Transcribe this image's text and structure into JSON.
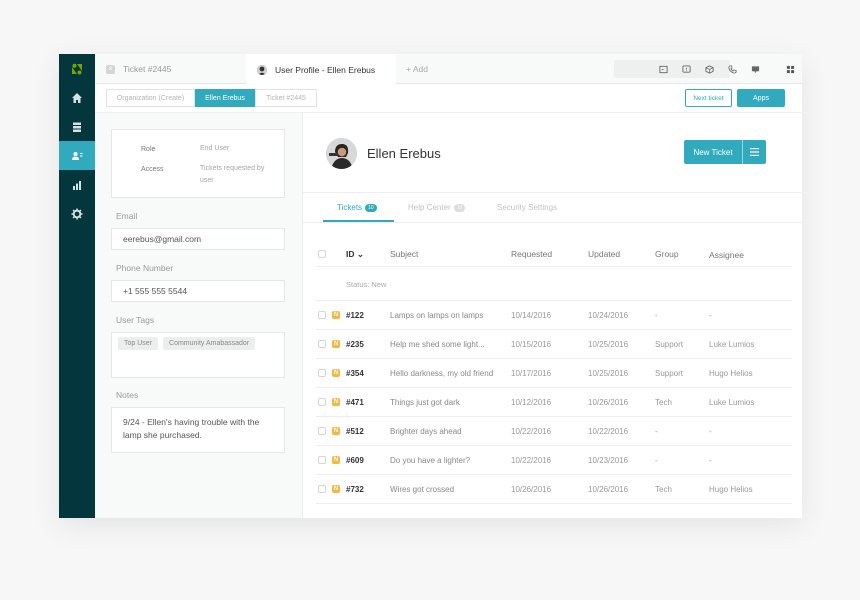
{
  "tabs": {
    "ticket": "Ticket #2445",
    "user_profile": "User Profile - Ellen Erebus",
    "add": "+ Add"
  },
  "breadcrumbs": [
    "Organization (Create)",
    "Ellen Erebus",
    "Ticket #2445"
  ],
  "buttons": {
    "next_ticket": "Next ticket",
    "apps": "Apps",
    "new_ticket": "New Ticket"
  },
  "profile": {
    "role_label": "Role",
    "role_value": "End User",
    "access_label": "Access",
    "access_value": "Tickets requested by user",
    "email_label": "Email",
    "email_value": "eerebus@gmail.com",
    "phone_label": "Phone Number",
    "phone_value": "+1 555 555 5544",
    "tags_label": "User Tags",
    "tags": [
      "Top User",
      "Community Amabassador"
    ],
    "notes_label": "Notes",
    "notes_value": "9/24 - Ellen's having trouble with the lamp she purchased."
  },
  "user": {
    "name": "Ellen Erebus"
  },
  "subtabs": [
    {
      "label": "Tickets",
      "count": "10"
    },
    {
      "label": "Help Center",
      "count": "10"
    },
    {
      "label": "Security Settings"
    }
  ],
  "table": {
    "columns": [
      "ID",
      "Subject",
      "Requested",
      "Updated",
      "Group",
      "Assignee"
    ],
    "status_label": "Status: New",
    "rows": [
      {
        "id": "#122",
        "subject": "Lamps on lamps on lamps",
        "requested": "10/14/2016",
        "updated": "10/24/2016",
        "group": "-",
        "assignee": "-"
      },
      {
        "id": "#235",
        "subject": "Help me shed some light...",
        "requested": "10/15/2016",
        "updated": "10/25/2016",
        "group": "Support",
        "assignee": "Luke Lumios"
      },
      {
        "id": "#354",
        "subject": "Hello darkness, my old friend",
        "requested": "10/17/2016",
        "updated": "10/25/2016",
        "group": "Support",
        "assignee": "Hugo Helios"
      },
      {
        "id": "#471",
        "subject": "Things just got dark",
        "requested": "10/12/2016",
        "updated": "10/26/2016",
        "group": "Tech",
        "assignee": "Luke Lumios"
      },
      {
        "id": "#512",
        "subject": "Brighter days ahead",
        "requested": "10/22/2016",
        "updated": "10/22/2016",
        "group": "-",
        "assignee": "-"
      },
      {
        "id": "#609",
        "subject": "Do you have a lighter?",
        "requested": "10/22/2016",
        "updated": "10/23/2016",
        "group": "-",
        "assignee": "-"
      },
      {
        "id": "#732",
        "subject": "Wires got crossed",
        "requested": "10/26/2016",
        "updated": "10/26/2016",
        "group": "Tech",
        "assignee": "Hugo Helios"
      }
    ],
    "badge_letter": "N"
  },
  "colors": {
    "accent": "#30aabc",
    "nav": "#03363d",
    "badge": "#f5b740",
    "logo": "#78a300"
  }
}
